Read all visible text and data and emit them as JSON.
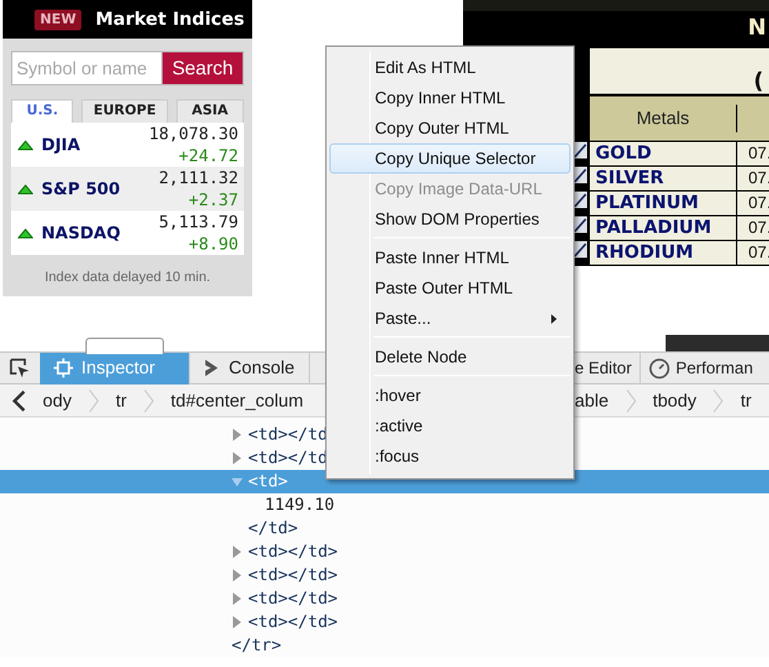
{
  "market_widget": {
    "badge": "NEW",
    "title": "Market Indices",
    "search": {
      "placeholder": "Symbol or name",
      "button": "Search"
    },
    "tabs": [
      {
        "label": "U.S.",
        "selected": true
      },
      {
        "label": "EUROPE",
        "selected": false
      },
      {
        "label": "ASIA",
        "selected": false
      }
    ],
    "indices": [
      {
        "name": "DJIA",
        "value": "18,078.30",
        "change": "+24.72"
      },
      {
        "name": "S&P 500",
        "value": "2,111.32",
        "change": "+2.37"
      },
      {
        "name": "NASDAQ",
        "value": "5,113.79",
        "change": "+8.90"
      }
    ],
    "footnote": "Index data delayed 10 min."
  },
  "kitco": {
    "heading": "N",
    "subheading": "(",
    "columns": [
      "Metals"
    ],
    "rows": [
      {
        "metal": "GOLD",
        "column_2": "07."
      },
      {
        "metal": "SILVER",
        "column_2": "07."
      },
      {
        "metal": "PLATINUM",
        "column_2": "07."
      },
      {
        "metal": "PALLADIUM",
        "column_2": "07."
      },
      {
        "metal": "RHODIUM",
        "column_2": "07."
      }
    ]
  },
  "devtools": {
    "tabs": [
      {
        "label": "Inspector",
        "selected": true
      },
      {
        "label": "Console",
        "selected": false
      },
      {
        "label": "e Editor",
        "selected": false
      },
      {
        "label": "Performan",
        "selected": false
      }
    ],
    "breadcrumbs_left": [
      "ody",
      "tr",
      "td#center_colum"
    ],
    "breadcrumbs_right": [
      "able",
      "tbody",
      "tr"
    ],
    "markup": {
      "closing": "</tr>",
      "children": [
        {
          "kind": "element",
          "tag": "<td></td",
          "expanded": false,
          "selected": false
        },
        {
          "kind": "element",
          "tag": "<td></td",
          "expanded": false,
          "selected": false
        },
        {
          "kind": "element",
          "tag": "<td>",
          "expanded": true,
          "selected": true,
          "closing": "</td>",
          "children": [
            {
              "kind": "text",
              "text": "1149.10",
              "selected": false
            }
          ]
        },
        {
          "kind": "element",
          "tag": "<td></td>",
          "expanded": false,
          "selected": false
        },
        {
          "kind": "element",
          "tag": "<td></td>",
          "expanded": false,
          "selected": false
        },
        {
          "kind": "element",
          "tag": "<td></td>",
          "expanded": false,
          "selected": false
        },
        {
          "kind": "element",
          "tag": "<td></td>",
          "expanded": false,
          "selected": false
        }
      ]
    }
  },
  "context_menu": {
    "items": [
      {
        "kind": "item",
        "label": "Edit As HTML",
        "highlighted": false,
        "disabled": false,
        "submenu": false
      },
      {
        "kind": "item",
        "label": "Copy Inner HTML",
        "highlighted": false,
        "disabled": false,
        "submenu": false
      },
      {
        "kind": "item",
        "label": "Copy Outer HTML",
        "highlighted": false,
        "disabled": false,
        "submenu": false
      },
      {
        "kind": "item",
        "label": "Copy Unique Selector",
        "highlighted": true,
        "disabled": false,
        "submenu": false
      },
      {
        "kind": "item",
        "label": "Copy Image Data-URL",
        "highlighted": false,
        "disabled": true,
        "submenu": false
      },
      {
        "kind": "item",
        "label": "Show DOM Properties",
        "highlighted": false,
        "disabled": false,
        "submenu": false
      },
      {
        "kind": "separator"
      },
      {
        "kind": "item",
        "label": "Paste Inner HTML",
        "highlighted": false,
        "disabled": false,
        "submenu": false
      },
      {
        "kind": "item",
        "label": "Paste Outer HTML",
        "highlighted": false,
        "disabled": false,
        "submenu": false
      },
      {
        "kind": "item",
        "label": "Paste...",
        "highlighted": false,
        "disabled": false,
        "submenu": true
      },
      {
        "kind": "separator"
      },
      {
        "kind": "item",
        "label": "Delete Node",
        "highlighted": false,
        "disabled": false,
        "submenu": false
      },
      {
        "kind": "separator"
      },
      {
        "kind": "item",
        "label": ":hover",
        "highlighted": false,
        "disabled": false,
        "submenu": false
      },
      {
        "kind": "item",
        "label": ":active",
        "highlighted": false,
        "disabled": false,
        "submenu": false
      },
      {
        "kind": "item",
        "label": ":focus",
        "highlighted": false,
        "disabled": false,
        "submenu": false
      }
    ]
  }
}
